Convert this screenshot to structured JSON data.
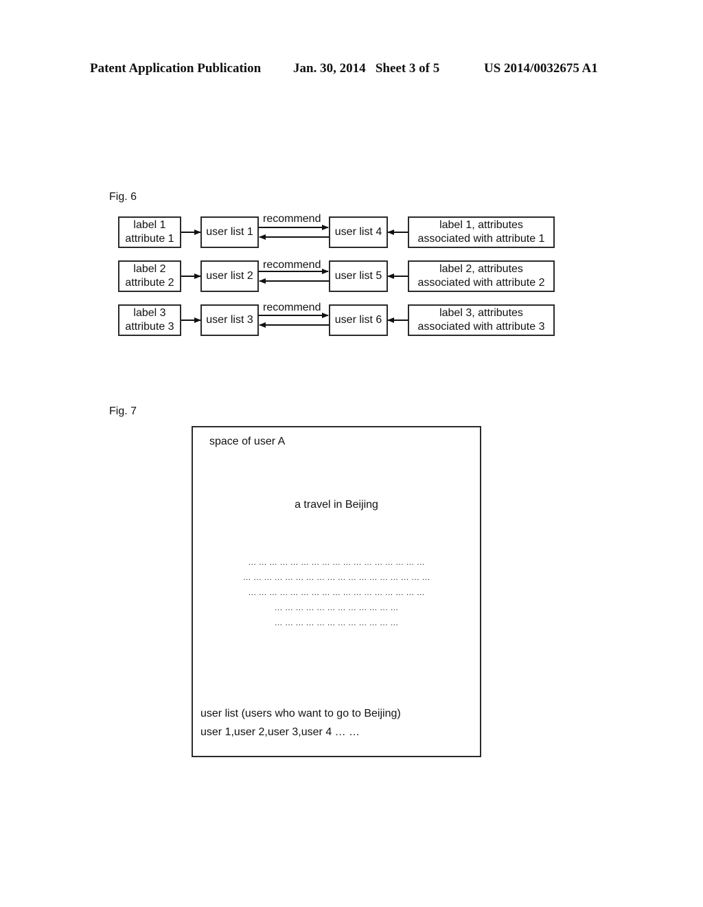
{
  "header": {
    "publication": "Patent Application Publication",
    "date_sheet": "Jan. 30, 2014   Sheet 3 of 5",
    "number": "US 2014/0032675 A1"
  },
  "fig6": {
    "label": "Fig. 6",
    "rows": [
      {
        "source_line1": "label 1",
        "source_line2": "attribute 1",
        "list_left": "user list 1",
        "edge_label": "recommend",
        "list_right": "user list 4",
        "target_line1": "label 1, attributes",
        "target_line2": "associated with attribute 1"
      },
      {
        "source_line1": "label 2",
        "source_line2": "attribute 2",
        "list_left": "user list 2",
        "edge_label": "recommend",
        "list_right": "user list 5",
        "target_line1": "label 2, attributes",
        "target_line2": "associated with attribute 2"
      },
      {
        "source_line1": "label 3",
        "source_line2": "attribute 3",
        "list_left": "user list 3",
        "edge_label": "recommend",
        "list_right": "user list 6",
        "target_line1": "label 3, attributes",
        "target_line2": "associated with attribute 3"
      }
    ]
  },
  "fig7": {
    "label": "Fig. 7",
    "space_title": "space of user A",
    "post_title": "a travel in Beijing",
    "placeholder_lines": [
      "… … … … … … … … … … … … … … … … …",
      "… … … … … … … … … … … … … … … … … …",
      "… … … … … … … … … … … … … … … … …",
      "… … … … … … … … … … … …",
      "… … … … … … … … … … … …"
    ],
    "user_list_heading": "user list (users who want to go to Beijing)",
    "user_list_values": "user 1,user 2,user 3,user 4 … …"
  }
}
